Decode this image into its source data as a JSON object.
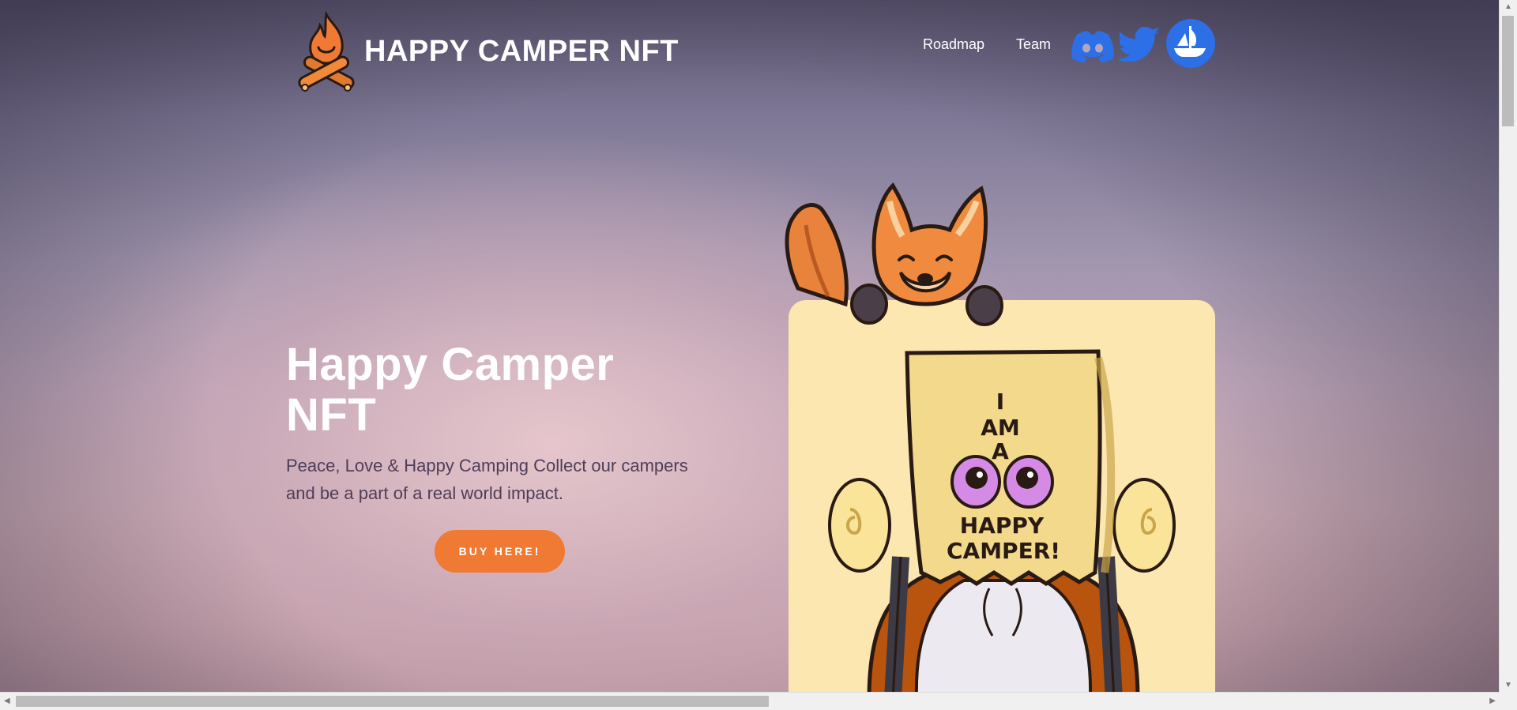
{
  "brand": {
    "name": "HAPPY CAMPER NFT",
    "logo_icon": "campfire-logo-icon"
  },
  "nav": {
    "links": [
      {
        "label": "Roadmap"
      },
      {
        "label": "Team"
      }
    ],
    "social": [
      {
        "icon": "discord-icon",
        "color": "#2c6fe6"
      },
      {
        "icon": "twitter-icon",
        "color": "#2c6fe6"
      },
      {
        "icon": "opensea-icon",
        "color": "#2c6fe6"
      }
    ]
  },
  "hero": {
    "title": "Happy Camper NFT",
    "subtitle": "Peace, Love & Happy Camping  Collect our campers and be a part of a real world impact.",
    "cta_label": "BUY HERE!",
    "cta_color": "#f07a33"
  },
  "artwork": {
    "bag_text": [
      "I",
      "AM",
      "A",
      "HAPPY",
      "CAMPER!"
    ],
    "card_color": "#fde7b0"
  }
}
